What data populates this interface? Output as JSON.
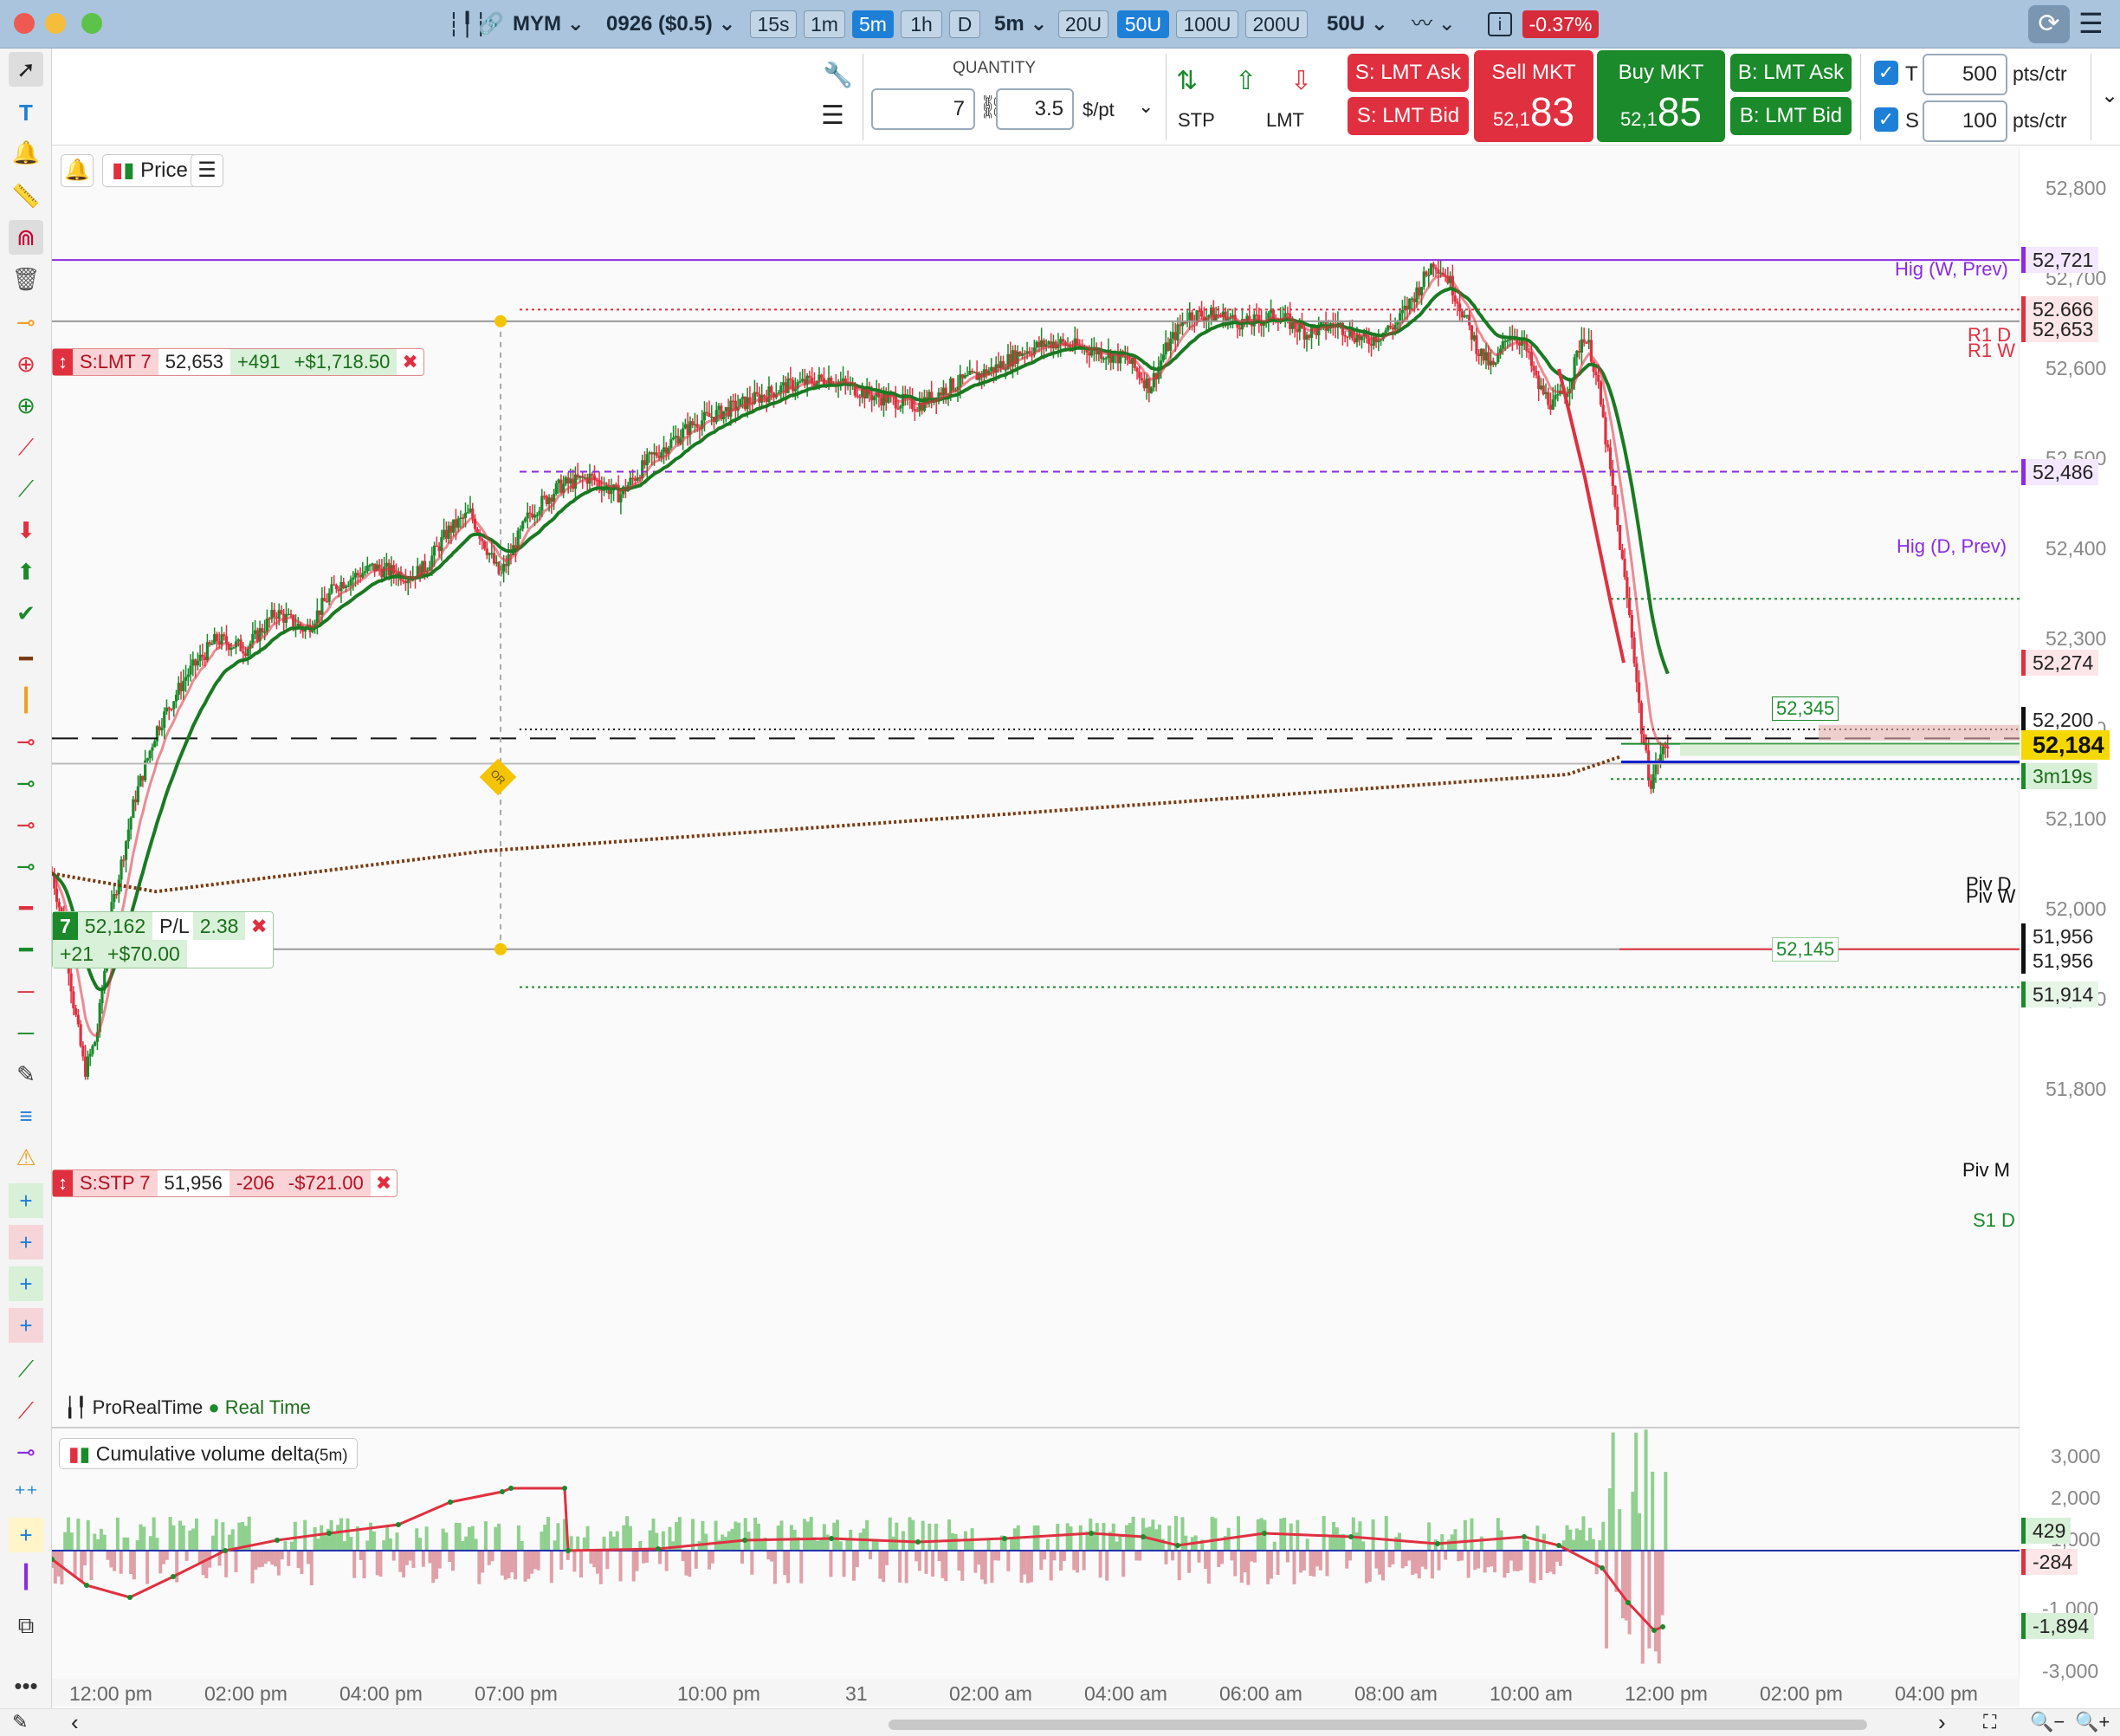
{
  "toolbar": {
    "symbol": "MYM",
    "contract": "0926 ($0.5)",
    "timeframes": [
      "15s",
      "1m",
      "5m",
      "1h",
      "D"
    ],
    "active_timeframe": "5m",
    "interval_dropdown": "5m",
    "range_buttons": [
      "20U",
      "50U",
      "100U",
      "200U"
    ],
    "active_range": "50U",
    "range_dropdown": "50U",
    "change_badge": "-0.37%"
  },
  "order_panel": {
    "quantity_label": "QUANTITY",
    "quantity_value": "7",
    "pt_value": "3.5",
    "pt_unit": "$/pt",
    "stp_label": "STP",
    "lmt_label": "LMT",
    "sell_lmt_ask": "S: LMT Ask",
    "sell_lmt_bid": "S: LMT Bid",
    "sell_mkt_label": "Sell MKT",
    "sell_mkt_price_small": "52,1",
    "sell_mkt_price_big": "83",
    "buy_mkt_label": "Buy MKT",
    "buy_mkt_price_small": "52,1",
    "buy_mkt_price_big": "85",
    "buy_lmt_ask": "B: LMT Ask",
    "buy_lmt_bid": "B: LMT Bid",
    "target_label": "T",
    "target_value": "500",
    "stop_label": "S",
    "stop_value": "100",
    "pts_unit": "pts/ctr"
  },
  "chart_header": {
    "price_button": "Price",
    "provider": "ProRealTime",
    "realtime": "Real Time",
    "cvd_title": "Cumulative volume delta",
    "cvd_tf": "(5m)"
  },
  "orders": {
    "limit": {
      "label": "S:LMT 7",
      "price": "52,653",
      "pts": "+491",
      "pl": "+$1,718.50"
    },
    "stop": {
      "label": "S:STP 7",
      "price": "51,956",
      "pts": "-206",
      "pl": "-$721.00"
    },
    "position": {
      "qty": "7",
      "price": "52,162",
      "pl_label": "P/L",
      "pl_ratio": "2.38",
      "pts": "+21",
      "pl": "+$70.00"
    }
  },
  "levels": {
    "hig_w": "Hig (W, Prev)",
    "hig_d": "Hig (D, Prev)",
    "r1d": "R1 D",
    "r1w": "R1 W",
    "pivd": "Piv D",
    "pivw": "Piv W",
    "pivm": "Piv M",
    "s1d": "S1 D",
    "or_marker": "OR"
  },
  "price_tags": {
    "t52721": "52,721",
    "t52666": "52,666",
    "t52653": "52,653",
    "t52486": "52,486",
    "t52345": "52,345",
    "t52274": "52,274",
    "t52200": "52,200",
    "t52184": "52,184",
    "timer": "3m19s",
    "t52145": "52,145",
    "t51956a": "51,956",
    "t51956b": "51,956",
    "t51914": "51,914"
  },
  "cvd_tags": {
    "a": "429",
    "b": "-284",
    "c": "-1,894"
  },
  "colors": {
    "up": "#1a8a2a",
    "down": "#e03040",
    "vwap": "#7a3b12",
    "hig": "#8a2be2",
    "accent": "#1e7fd6"
  },
  "chart_data": {
    "type": "candlestick",
    "y_axis_ticks": [
      "52,800",
      "52,700",
      "52,600",
      "52,500",
      "52,400",
      "52,300",
      "52,200",
      "52,100",
      "52,000",
      "51,900",
      "51,800"
    ],
    "cvd_axis_ticks": [
      "3,000",
      "2,000",
      "1,000",
      "-1,000",
      "-3,000"
    ],
    "x_axis_ticks": [
      "12:00 pm",
      "02:00 pm",
      "04:00 pm",
      "07:00 pm",
      "10:00 pm",
      "31",
      "02:00 am",
      "04:00 am",
      "06:00 am",
      "08:00 am",
      "10:00 am",
      "12:00 pm",
      "02:00 pm",
      "04:00 pm"
    ],
    "ylim": [
      51750,
      52830
    ],
    "price_path": [
      [
        0,
        52040
      ],
      [
        8,
        51980
      ],
      [
        14,
        51900
      ],
      [
        22,
        51820
      ],
      [
        30,
        51860
      ],
      [
        40,
        52000
      ],
      [
        55,
        52120
      ],
      [
        70,
        52200
      ],
      [
        90,
        52260
      ],
      [
        110,
        52300
      ],
      [
        130,
        52290
      ],
      [
        150,
        52330
      ],
      [
        170,
        52310
      ],
      [
        190,
        52360
      ],
      [
        215,
        52380
      ],
      [
        240,
        52370
      ],
      [
        250,
        52380
      ],
      [
        265,
        52420
      ],
      [
        280,
        52440
      ],
      [
        300,
        52370
      ],
      [
        320,
        52440
      ],
      [
        340,
        52470
      ],
      [
        360,
        52480
      ],
      [
        380,
        52460
      ],
      [
        400,
        52500
      ],
      [
        430,
        52540
      ],
      [
        460,
        52560
      ],
      [
        490,
        52580
      ],
      [
        520,
        52590
      ],
      [
        550,
        52570
      ],
      [
        580,
        52560
      ],
      [
        600,
        52580
      ],
      [
        630,
        52600
      ],
      [
        650,
        52620
      ],
      [
        670,
        52630
      ],
      [
        700,
        52620
      ],
      [
        720,
        52610
      ],
      [
        735,
        52580
      ],
      [
        745,
        52620
      ],
      [
        760,
        52660
      ],
      [
        780,
        52660
      ],
      [
        800,
        52650
      ],
      [
        820,
        52660
      ],
      [
        840,
        52640
      ],
      [
        860,
        52650
      ],
      [
        880,
        52630
      ],
      [
        900,
        52650
      ],
      [
        915,
        52690
      ],
      [
        925,
        52720
      ],
      [
        935,
        52700
      ],
      [
        945,
        52660
      ],
      [
        955,
        52620
      ],
      [
        965,
        52600
      ],
      [
        975,
        52640
      ],
      [
        985,
        52630
      ],
      [
        995,
        52580
      ],
      [
        1005,
        52560
      ],
      [
        1015,
        52580
      ],
      [
        1025,
        52640
      ],
      [
        1030,
        52620
      ],
      [
        1035,
        52580
      ],
      [
        1042,
        52500
      ],
      [
        1050,
        52400
      ],
      [
        1058,
        52300
      ],
      [
        1064,
        52200
      ],
      [
        1070,
        52140
      ],
      [
        1076,
        52170
      ],
      [
        1082,
        52184
      ]
    ],
    "annotations": {
      "limit_order": 52653,
      "stop_order": 51956,
      "position_entry": 52162,
      "last": 52184
    }
  }
}
